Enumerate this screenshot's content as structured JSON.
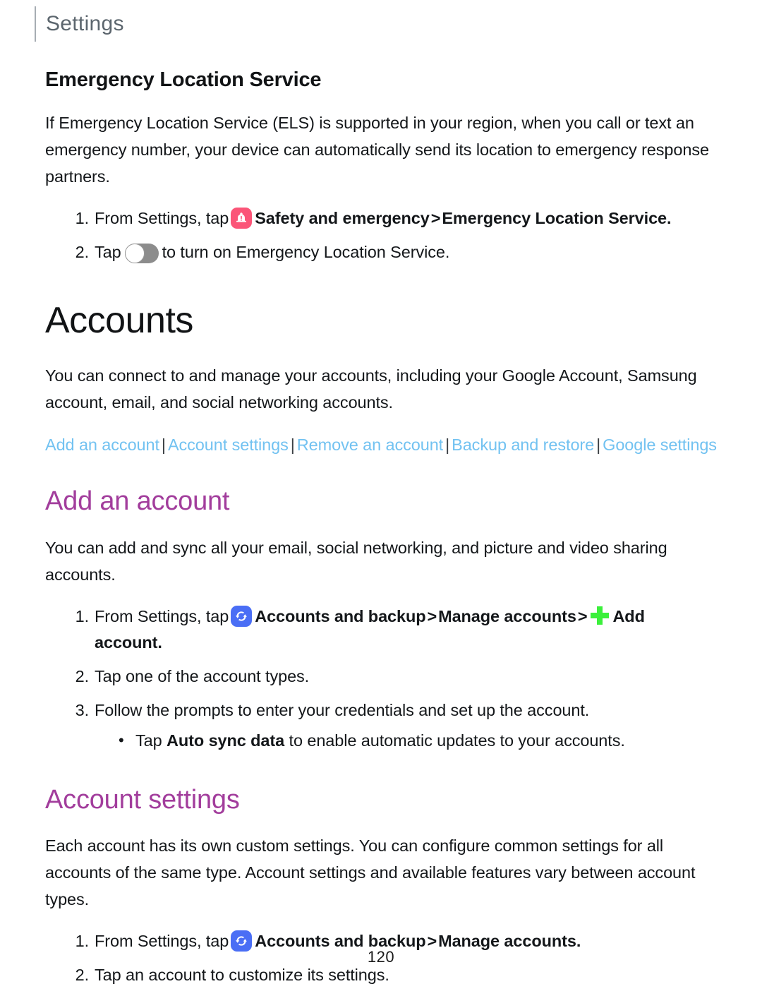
{
  "header": {
    "title": "Settings"
  },
  "els_section": {
    "heading": "Emergency Location Service",
    "paragraph": "If Emergency Location Service (ELS) is supported in your region, when you call or text an emergency number, your device can automatically send its location to emergency response partners.",
    "step1": {
      "prefix": "From Settings, tap",
      "icon": "safety-and-emergency-icon",
      "bold1": "Safety and emergency",
      "chevron": ">",
      "bold2": "Emergency Location Service",
      "suffix": "."
    },
    "step2": {
      "prefix": "Tap",
      "icon": "toggle-switch-off",
      "suffix": "to turn on Emergency Location Service."
    }
  },
  "accounts_section": {
    "heading": "Accounts",
    "paragraph": "You can connect to and manage your accounts, including your Google Account, Samsung account, email, and social networking accounts.",
    "nav_links": [
      "Add an account",
      "Account settings",
      "Remove an account",
      "Backup and restore",
      "Google settings"
    ],
    "nav_separator": "|"
  },
  "add_account_section": {
    "heading": "Add an account",
    "paragraph": "You can add and sync all your email, social networking, and picture and video sharing accounts.",
    "step1": {
      "prefix": "From Settings, tap",
      "icon": "accounts-and-backup-icon",
      "bold1": "Accounts and backup",
      "chevron1": ">",
      "bold2": "Manage accounts",
      "chevron2": ">",
      "plus_icon": "add-plus-icon",
      "bold3": "Add account."
    },
    "step2": "Tap one of the account types.",
    "step3": "Follow the prompts to enter your credentials and set up the account.",
    "bullet": {
      "prefix": "Tap",
      "bold": "Auto sync data",
      "suffix": "to enable automatic updates to your accounts."
    }
  },
  "account_settings_section": {
    "heading": "Account settings",
    "paragraph": "Each account has its own custom settings. You can configure common settings for all accounts of the same type. Account settings and available features vary between account types.",
    "step1": {
      "prefix": "From Settings, tap",
      "icon": "accounts-and-backup-icon",
      "bold1": "Accounts and backup",
      "chevron": ">",
      "bold2": "Manage accounts",
      "suffix": "."
    },
    "step2": "Tap an account to customize its settings."
  },
  "footer": {
    "page_number": "120"
  },
  "colors": {
    "purple_heading": "#a23d9c",
    "link_blue": "#72c2f1",
    "safety_icon_bg": "#fb5578",
    "accounts_icon_bg": "#4a6ef5",
    "plus_green": "#3bf03b",
    "header_gray": "#5c666e"
  }
}
